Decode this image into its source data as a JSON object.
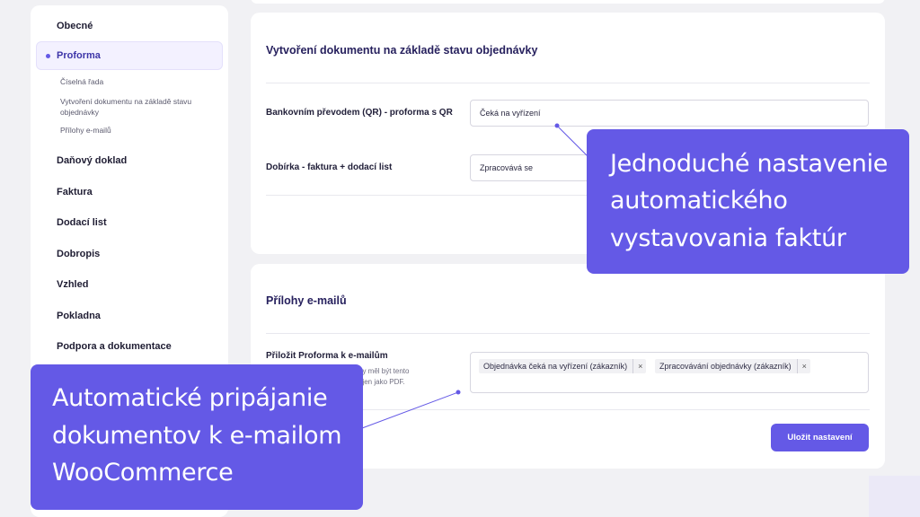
{
  "sidebar": {
    "items": [
      {
        "label": "Obecné"
      },
      {
        "label": "Proforma"
      },
      {
        "label": "Daňový doklad"
      },
      {
        "label": "Faktura"
      },
      {
        "label": "Dodací list"
      },
      {
        "label": "Dobropis"
      },
      {
        "label": "Vzhled"
      },
      {
        "label": "Pokladna"
      },
      {
        "label": "Podpora a dokumentace"
      }
    ],
    "subitems": [
      {
        "label": "Číselná řada"
      },
      {
        "label": "Vytvoření dokumentu na základě stavu objednávky"
      },
      {
        "label": "Přílohy e-mailů"
      }
    ]
  },
  "section1": {
    "title": "Vytvoření dokumentu na základě stavu objednávky",
    "fields": [
      {
        "label": "Bankovním převodem (QR) - proforma s QR",
        "value": "Čeká na vyřízení"
      },
      {
        "label": "Dobírka - faktura + dodací list",
        "value": "Zpracovává se"
      }
    ]
  },
  "section2": {
    "title": "Přílohy e-mailů",
    "field_label": "Přiložit Proforma k e-mailům",
    "field_help": "...by měl být tento ...ojen jako PDF.",
    "help_line1": "by měl být tento",
    "help_line2": "ojen jako PDF.",
    "tags": [
      {
        "label": "Objednávka čeká na vyřízení (zákazník)",
        "remove": "×"
      },
      {
        "label": "Zpracovávání objednávky (zákazník)",
        "remove": "×"
      }
    ],
    "save_label": "Uložit nastavení"
  },
  "callouts": {
    "first": [
      "Jednoduché nastavenie",
      "automatického",
      "vystavovania faktúr"
    ],
    "second": [
      "Automatické pripájanie",
      "dokumentov k e-mailom",
      "WooCommerce"
    ]
  },
  "colors": {
    "accent": "#6459e6",
    "background": "#f1f1f4",
    "card": "#ffffff"
  }
}
